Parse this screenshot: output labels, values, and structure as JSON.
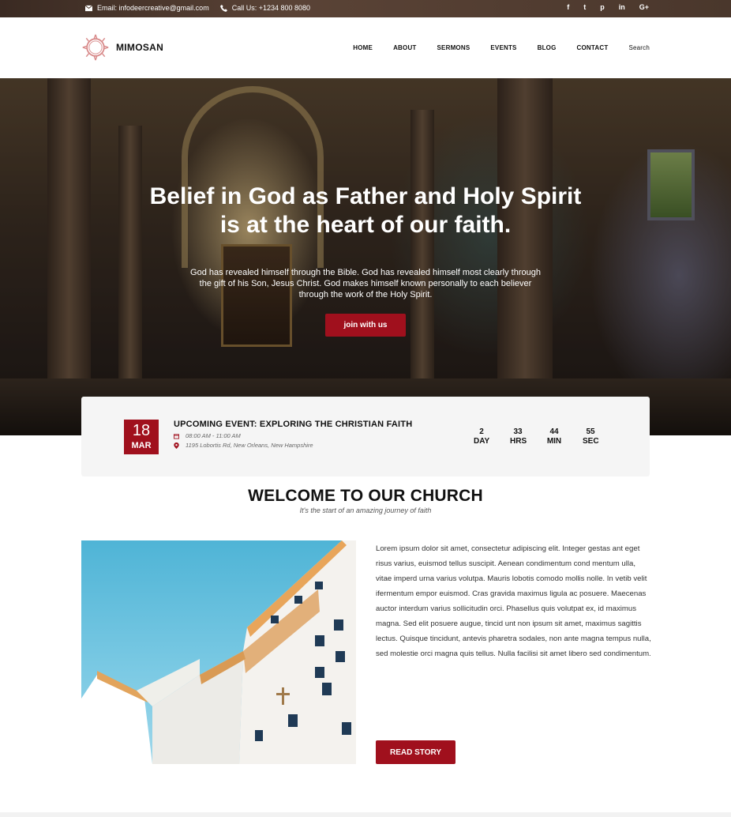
{
  "topbar": {
    "email": "Email: infodeercreative@gmail.com",
    "phone": "Call Us: +1234 800 8080",
    "social": [
      "f",
      "t",
      "p",
      "in",
      "G+"
    ]
  },
  "header": {
    "brand": "MIMOSAN",
    "nav": [
      "HOME",
      "ABOUT",
      "SERMONS",
      "EVENTS",
      "BLOG",
      "CONTACT",
      "Search"
    ]
  },
  "hero": {
    "title": "Belief in God as Father and Holy Spirit is at the heart of our faith.",
    "body": "God has revealed himself through the Bible. God has revealed himself most clearly through the gift of his Son, Jesus Christ. God makes himself known personally to each believer through the work of the Holy Spirit.",
    "cta": "join with us"
  },
  "event": {
    "day": "18",
    "month": "MAR",
    "title": "UPCOMING EVENT: EXPLORING THE CHRISTIAN FAITH",
    "time": "08:00 AM - 11:00 AM",
    "address": "1195 Lobortis Rd, New Orleans, New Hampshire",
    "countdown": [
      {
        "value": "2",
        "unit": "DAY"
      },
      {
        "value": "33",
        "unit": "HRS"
      },
      {
        "value": "44",
        "unit": "MIN"
      },
      {
        "value": "55",
        "unit": "SEC"
      }
    ]
  },
  "welcome": {
    "title": "WELCOME TO OUR CHURCH",
    "subtitle": "It's the start of an amazing journey of faith",
    "story": "Lorem ipsum dolor sit amet, consectetur adipiscing elit. Integer gestas ant eget risus varius, euismod tellus suscipit. Aenean condimentum cond mentum ulla, vitae imperd urna varius volutpa. Mauris lobotis comodo mollis nolle. In vetib velit ifermentum empor euismod. Cras gravida maximus ligula ac posuere. Maecenas auctor interdum varius sollicitudin orci. Phasellus quis volutpat ex, id maximus magna. Sed elit posuere augue, tincid unt non ipsum sit amet, maximus sagittis lectus. Quisque tincidunt, antevis pharetra sodales, non ante magna tempus nulla, sed molestie orci magna quis tellus. Nulla facilisi sit amet libero sed condimentum.",
    "cta": "READ STORY"
  },
  "colors": {
    "accent": "#a0101d",
    "topbar": "#4a372c"
  },
  "icons": [
    "envelope-icon",
    "phone-icon",
    "facebook-icon",
    "twitter-icon",
    "pinterest-icon",
    "linkedin-icon",
    "google-plus-icon",
    "calendar-icon",
    "map-pin-icon",
    "crown-of-thorns-logo"
  ]
}
